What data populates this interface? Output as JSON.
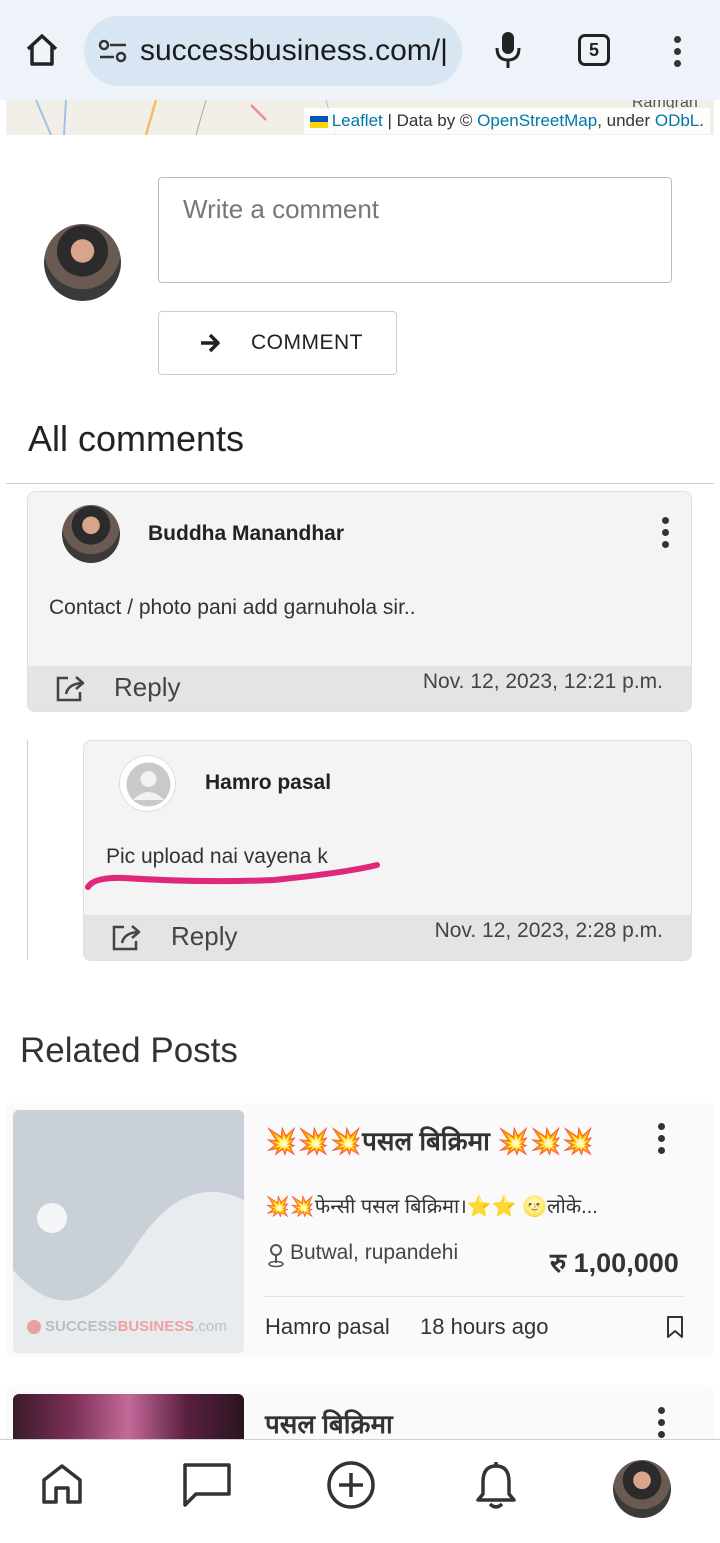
{
  "browser": {
    "url": "successbusiness.com/|",
    "tab_count": "5"
  },
  "map": {
    "place_label": "Ramgran",
    "attribution": {
      "leaflet": "Leaflet",
      "separator_text": " | Data by © ",
      "osm": "OpenStreetMap",
      "under": ", under ",
      "odbl": "ODbL",
      "end": "."
    }
  },
  "comment_form": {
    "placeholder": "Write a comment",
    "submit_label": "COMMENT"
  },
  "comments_section": {
    "heading": "All comments",
    "comments": [
      {
        "author": "Buddha Manandhar",
        "text": "Contact / photo pani add garnuhola sir..",
        "reply_label": "Reply",
        "date": "Nov. 12, 2023, 12:21 p.m."
      },
      {
        "author": "Hamro pasal",
        "text": "Pic upload nai vayena k",
        "reply_label": "Reply",
        "date": "Nov. 12, 2023, 2:28 p.m."
      }
    ]
  },
  "related_posts": {
    "heading": "Related Posts",
    "posts": [
      {
        "title": "💥💥💥पसल बिक्रिमा 💥💥💥",
        "description": "💥💥फेन्सी पसल बिक्रिमा।⭐⭐ 🌝लोके...",
        "location": "Butwal, rupandehi",
        "price": "रु 1,00,000",
        "seller": "Hamro pasal",
        "time": "18 hours ago",
        "watermark_prefix": "SUCCESS",
        "watermark_brand": "BUSINESS",
        "watermark_suffix": ".com"
      },
      {
        "title": "पसल बिक्रिमा"
      }
    ]
  },
  "colors": {
    "annotation_underline": "#e0287a",
    "link": "#0078a8"
  }
}
